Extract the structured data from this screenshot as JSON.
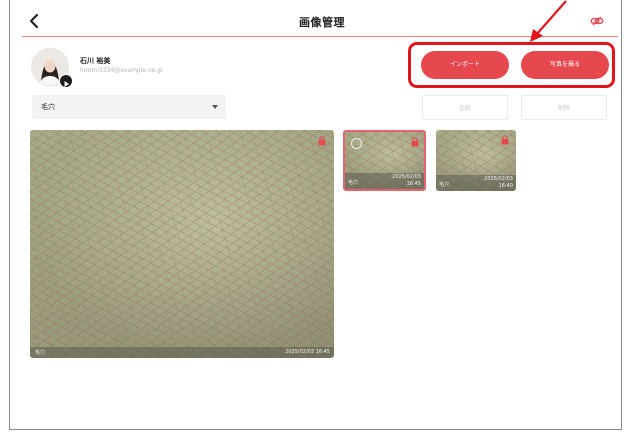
{
  "header": {
    "title": "画像管理"
  },
  "user": {
    "name": "石川 裕美",
    "email": "hiromi3334@example.ne.jp"
  },
  "actions": {
    "import_label": "インポート",
    "take_photo_label": "写真を撮る",
    "compare_label": "比較",
    "delete_label": "削除"
  },
  "filter": {
    "selected": "毛穴"
  },
  "main_photo": {
    "category": "毛穴",
    "timestamp": "2025/02/03 16:45"
  },
  "thumbnails": [
    {
      "category": "毛穴",
      "date": "2025/02/03",
      "time": "16:45",
      "selected": true
    },
    {
      "category": "毛穴",
      "date": "2025/02/03",
      "time": "16:40",
      "selected": false
    }
  ],
  "colors": {
    "accent": "#e5484d",
    "highlight": "#e3141c",
    "header_line": "#ef7d7d"
  },
  "icons": {
    "back": "chevron-left-icon",
    "link": "unlink-icon",
    "lock": "lock-icon"
  }
}
